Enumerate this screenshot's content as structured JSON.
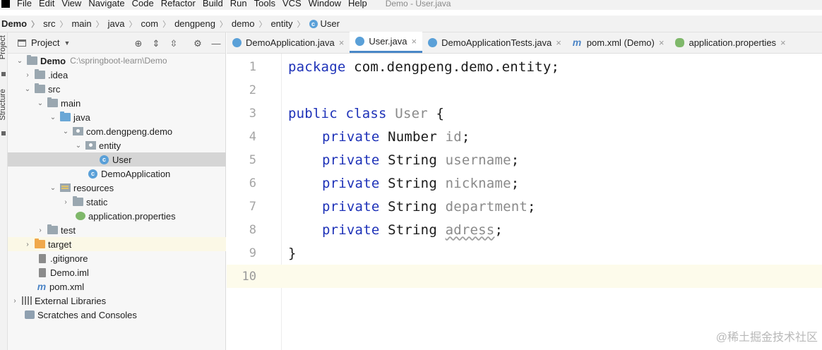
{
  "menubar": {
    "items": [
      "File",
      "Edit",
      "View",
      "Navigate",
      "Code",
      "Refactor",
      "Build",
      "Run",
      "Tools",
      "VCS",
      "Window",
      "Help"
    ],
    "window_title": "Demo - User.java"
  },
  "breadcrumb": [
    "Demo",
    "src",
    "main",
    "java",
    "com",
    "dengpeng",
    "demo",
    "entity",
    "User"
  ],
  "left_strip": {
    "project_label": "Project",
    "structure_label": "Structure"
  },
  "project_panel": {
    "title": "Project",
    "tree": [
      {
        "label": "Demo",
        "path": "C:\\springboot-learn\\Demo"
      },
      {
        "label": ".idea"
      },
      {
        "label": "src"
      },
      {
        "label": "main"
      },
      {
        "label": "java"
      },
      {
        "label": "com.dengpeng.demo"
      },
      {
        "label": "entity"
      },
      {
        "label": "User"
      },
      {
        "label": "DemoApplication"
      },
      {
        "label": "resources"
      },
      {
        "label": "static"
      },
      {
        "label": "application.properties"
      },
      {
        "label": "test"
      },
      {
        "label": "target"
      },
      {
        "label": ".gitignore"
      },
      {
        "label": "Demo.iml"
      },
      {
        "label": "pom.xml"
      },
      {
        "label": "External Libraries"
      },
      {
        "label": "Scratches and Consoles"
      }
    ]
  },
  "tabs": [
    {
      "label": "DemoApplication.java",
      "active": false,
      "icon": "class-icon"
    },
    {
      "label": "User.java",
      "active": true,
      "icon": "class-icon"
    },
    {
      "label": "DemoApplicationTests.java",
      "active": false,
      "icon": "test-class-icon"
    },
    {
      "label": "pom.xml (Demo)",
      "active": false,
      "icon": "maven-icon"
    },
    {
      "label": "application.properties",
      "active": false,
      "icon": "spring-icon"
    }
  ],
  "editor": {
    "line_numbers": [
      "1",
      "2",
      "3",
      "4",
      "5",
      "6",
      "7",
      "8",
      "9",
      "10"
    ],
    "current_line": 10,
    "code": {
      "l1_kw": "package",
      "l1_rest": " com.dengpeng.demo.entity;",
      "l3_kw": "public class",
      "l3_name": " User",
      "l3_rest": " {",
      "private_kw": "private",
      "l4_type": " Number ",
      "l4_field": "id",
      "l5_type": " String ",
      "l5_field": "username",
      "l6_type": " String ",
      "l6_field": "nickname",
      "l7_type": " String ",
      "l7_field": "department",
      "l8_type": " String ",
      "l8_field": "adress",
      "semicolon": ";",
      "l9": "}"
    }
  },
  "watermark": "@稀土掘金技术社区",
  "colors": {
    "keyword": "#1e32b8",
    "field": "#8a8a8a",
    "accent_tab": "#4a88c7",
    "selected_row": "#d5d5d5"
  }
}
